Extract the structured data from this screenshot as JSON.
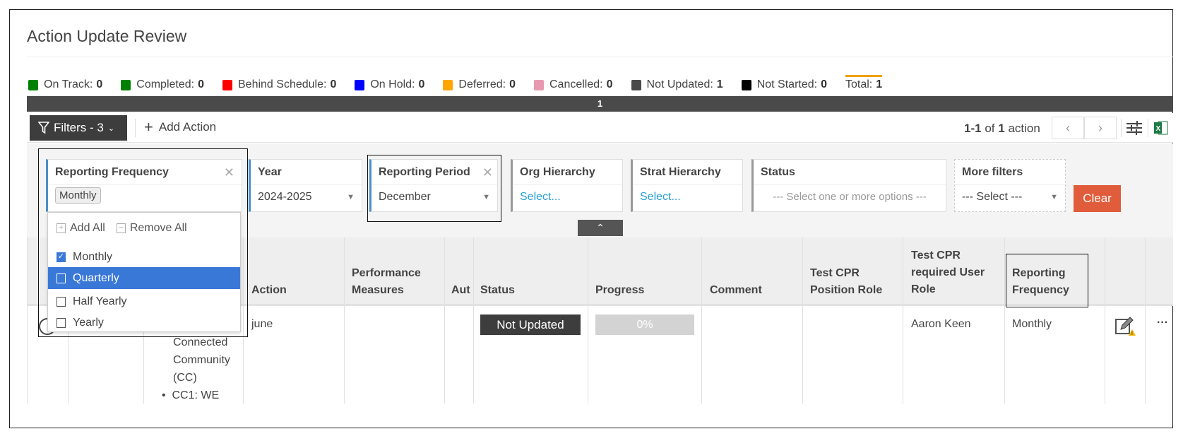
{
  "page": {
    "title": "Action Update Review"
  },
  "legend": [
    {
      "label": "On Track:",
      "count": "0",
      "color": "#008000"
    },
    {
      "label": "Completed:",
      "count": "0",
      "color": "#008000"
    },
    {
      "label": "Behind Schedule:",
      "count": "0",
      "color": "#ff0000"
    },
    {
      "label": "On Hold:",
      "count": "0",
      "color": "#0000ff"
    },
    {
      "label": "Deferred:",
      "count": "0",
      "color": "#ffa500"
    },
    {
      "label": "Cancelled:",
      "count": "0",
      "color": "#e899b0"
    },
    {
      "label": "Not Updated:",
      "count": "1",
      "color": "#4a4a4a"
    },
    {
      "label": "Not Started:",
      "count": "0",
      "color": "#000000"
    }
  ],
  "total": {
    "label": "Total:",
    "count": "1"
  },
  "status_bar": {
    "value": "1"
  },
  "toolbar": {
    "filters_label": "Filters - 3",
    "add_action": "Add Action",
    "pager_range": "1-1",
    "pager_of": "of",
    "pager_count": "1",
    "pager_unit": "action"
  },
  "filters": {
    "reporting_frequency": {
      "label": "Reporting Frequency",
      "chip": "Monthly",
      "add_all": "Add All",
      "remove_all": "Remove All",
      "options": [
        {
          "label": "Monthly",
          "checked": true
        },
        {
          "label": "Quarterly",
          "checked": false,
          "highlighted": true
        },
        {
          "label": "Half Yearly",
          "checked": false
        },
        {
          "label": "Yearly",
          "checked": false
        }
      ]
    },
    "year": {
      "label": "Year",
      "value": "2024-2025"
    },
    "reporting_period": {
      "label": "Reporting Period",
      "value": "December"
    },
    "org_hierarchy": {
      "label": "Org Hierarchy",
      "value": "Select..."
    },
    "strat_hierarchy": {
      "label": "Strat Hierarchy",
      "value": "Select..."
    },
    "status": {
      "label": "Status",
      "placeholder": "--- Select one or more options ---"
    },
    "more_filters": {
      "label": "More filters",
      "value": "--- Select ---"
    },
    "clear": "Clear"
  },
  "table": {
    "headers": {
      "action": "Action",
      "performance_measures_1": "Performance",
      "performance_measures_2": "Measures",
      "aut": "Aut",
      "status": "Status",
      "progress": "Progress",
      "comment": "Comment",
      "position_role_1": "Test CPR",
      "position_role_2": "Position Role",
      "user_role_1": "Test CPR",
      "user_role_2": "required User",
      "user_role_3": "Role",
      "frequency_1": "Reporting",
      "frequency_2": "Frequency"
    },
    "row": {
      "strat_1": "Connected",
      "strat_2": "Community",
      "strat_3": "(CC)",
      "strat_bullet": "CC1: WE",
      "action": "june",
      "status": "Not Updated",
      "progress": "0%",
      "user_role": "Aaron Keen",
      "frequency": "Monthly"
    }
  }
}
